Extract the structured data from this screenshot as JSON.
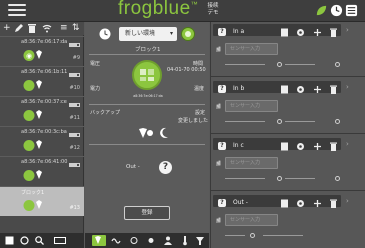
{
  "app": {
    "brand": "frogblue",
    "brand_mark": "™",
    "center_title_line1": "接续",
    "center_title_line2": "デモ"
  },
  "left": {
    "devices": [
      {
        "name": "a8:36:7e:06:17:da",
        "num": "#9",
        "selected": false
      },
      {
        "name": "a8:36:7e:06:1b:11",
        "num": "#10",
        "selected": false
      },
      {
        "name": "a8:36:7e:00:37:ce",
        "num": "#11",
        "selected": false
      },
      {
        "name": "a8:36:7e:00:3c:ba",
        "num": "#12",
        "selected": false
      },
      {
        "name": "a8:36:7e:06:41:00",
        "num": "",
        "selected": false
      },
      {
        "name": "ブロック1",
        "num": "#13",
        "selected": true
      }
    ]
  },
  "center": {
    "schedule_select": "新しい環境",
    "block_name": "ブロック1",
    "voltage_label": "電圧",
    "time_label": "時間",
    "time_value": "04-01-70 00:50",
    "power_label": "電力",
    "temperature_label": "温度",
    "backup_label": "バックアップ",
    "settings_label": "設定",
    "settings_value": "変更しました",
    "gauge_text": "a8:36:7e:06:17:da",
    "out_label": "Out -",
    "register_button": "登録"
  },
  "right": {
    "ports": [
      {
        "name": "In a",
        "field": "センサー入力"
      },
      {
        "name": "In b",
        "field": "センサー入力"
      },
      {
        "name": "In c",
        "field": "センサー入力"
      },
      {
        "name": "Out -",
        "field": "センサー入力"
      }
    ]
  },
  "colors": {
    "accent": "#8cc63f",
    "panel_dark": "#3b3b3b",
    "panel": "#595959"
  }
}
